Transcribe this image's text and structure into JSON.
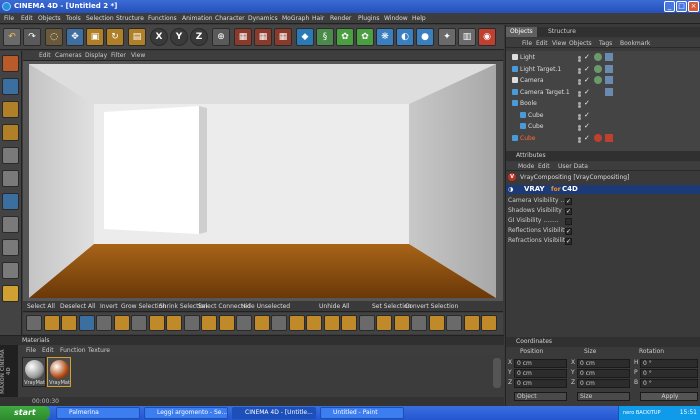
{
  "window": {
    "title": "CINEMA 4D - [Untitled 2 *]",
    "min": "_",
    "max": "□",
    "close": "×"
  },
  "menu": [
    "File",
    "Edit",
    "Objects",
    "Tools",
    "Selection",
    "Structure",
    "Functions",
    "Animation",
    "Character",
    "Dynamics",
    "MoGraph",
    "Hair",
    "Render",
    "Plugins",
    "Window",
    "Help"
  ],
  "toolbar": {
    "axis_x": "X",
    "axis_y": "Y",
    "axis_z": "Z"
  },
  "viewport": {
    "menu": [
      "Edit",
      "Cameras",
      "Display",
      "Filter",
      "View"
    ]
  },
  "selection_bar": [
    "Select All",
    "Deselect All",
    "Invert",
    "Grow Selection",
    "Shrink Selection",
    "Select Connected",
    "Hide Unselected",
    "Unhide All",
    "Set Selection",
    "Convert Selection"
  ],
  "objects_panel": {
    "tabs": [
      "Objects",
      "Structure"
    ],
    "menu": [
      "File",
      "Edit",
      "View",
      "Objects",
      "Tags",
      "Bookmark"
    ],
    "rows": [
      {
        "name": "Light",
        "indent": 0,
        "icon": "light-icon"
      },
      {
        "name": "Light Target.1",
        "indent": 0,
        "icon": "target-icon"
      },
      {
        "name": "Camera",
        "indent": 0,
        "icon": "camera-icon"
      },
      {
        "name": "Camera Target.1",
        "indent": 0,
        "icon": "target-icon"
      },
      {
        "name": "Boole",
        "indent": 0,
        "icon": "boole-icon"
      },
      {
        "name": "Cube",
        "indent": 1,
        "icon": "cube-icon"
      },
      {
        "name": "Cube",
        "indent": 1,
        "icon": "cube-icon"
      },
      {
        "name": "Cube",
        "indent": 0,
        "icon": "cube-icon",
        "highlight": true
      }
    ]
  },
  "attributes_panel": {
    "title": "Attributes",
    "menu": [
      "Mode",
      "Edit",
      "User Data"
    ],
    "object": "VrayCompositing [VrayCompositing]",
    "vray_label": "VRAY",
    "vray_suffix": "for",
    "vray_c4d": "C4D",
    "options": [
      {
        "label": "Camera Visibility ....",
        "checked": true
      },
      {
        "label": "Shadows Visibility",
        "checked": true
      },
      {
        "label": "GI Visibility ........",
        "checked": false
      },
      {
        "label": "Reflections Visibility",
        "checked": true
      },
      {
        "label": "Refractions Visibility",
        "checked": true
      }
    ]
  },
  "materials_panel": {
    "title": "Materials",
    "menu": [
      "File",
      "Edit",
      "Function",
      "Texture"
    ],
    "items": [
      {
        "name": "VrayMat",
        "color": "#9a9a9a"
      },
      {
        "name": "VrayMat",
        "color": "#b04a10"
      }
    ]
  },
  "coordinates_panel": {
    "title": "Coordinates",
    "headers": [
      "Position",
      "Size",
      "Rotation"
    ],
    "rows": [
      {
        "a": "X",
        "pos": "0 cm",
        "b": "X",
        "size": "0 cm",
        "c": "H",
        "rot": "0 °"
      },
      {
        "a": "Y",
        "pos": "0 cm",
        "b": "Y",
        "size": "0 cm",
        "c": "P",
        "rot": "0 °"
      },
      {
        "a": "Z",
        "pos": "0 cm",
        "b": "Z",
        "size": "0 cm",
        "c": "B",
        "rot": "0 °"
      }
    ],
    "mode": "Object",
    "size_mode": "Size",
    "apply": "Apply"
  },
  "status": {
    "time": "00:00:30"
  },
  "side_label": "MAXON CINEMA 4D",
  "taskbar": {
    "start": "start",
    "tasks": [
      "Palmerina",
      "Leggi argomento - Se...",
      "CINEMA 4D - [Untitle...",
      "Untitled - Paint"
    ],
    "tray_time": "15:51",
    "tray_brand": "nero BACKITUP"
  }
}
